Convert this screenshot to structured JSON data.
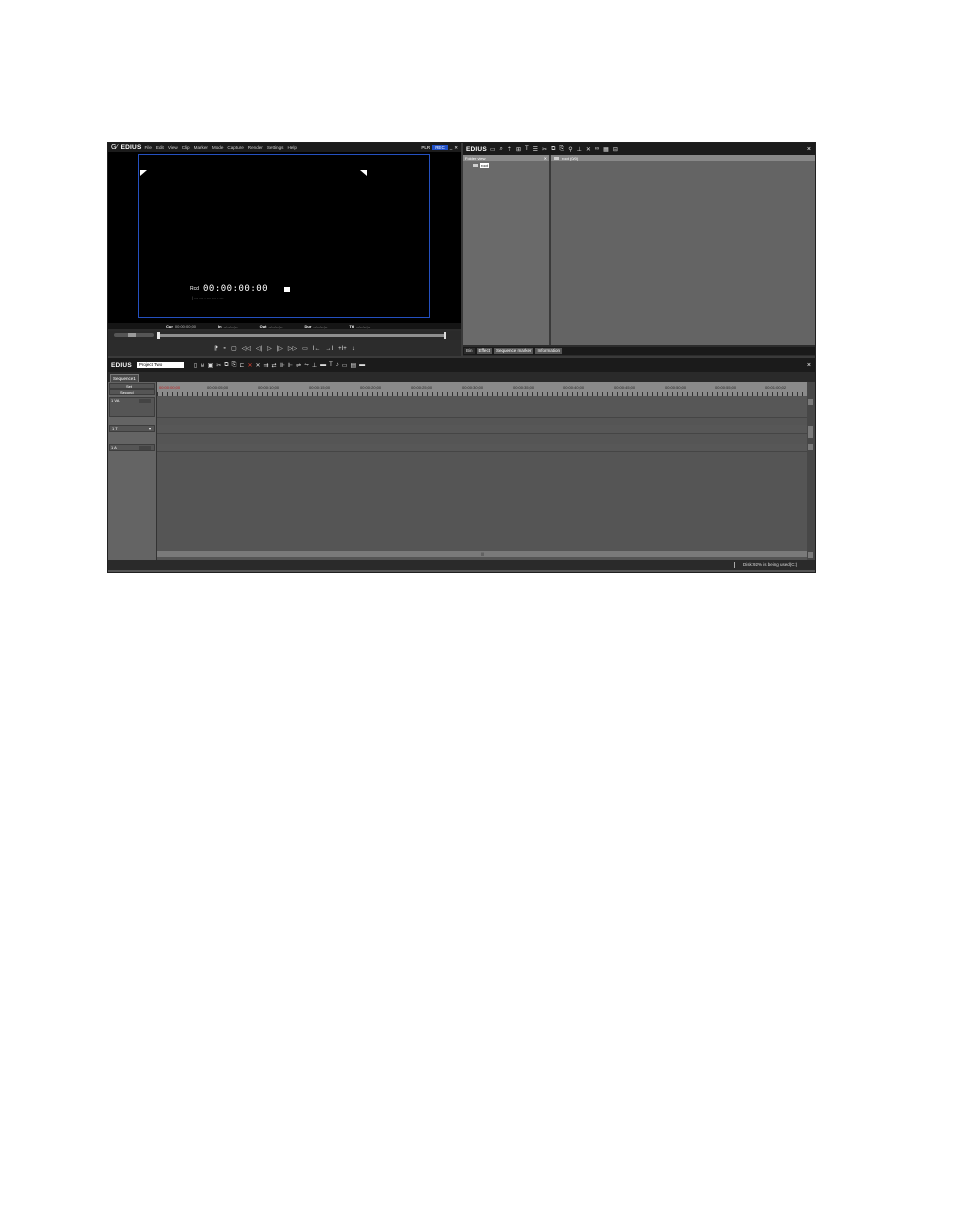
{
  "player": {
    "logo": "EDIUS",
    "menu": [
      "File",
      "Edit",
      "View",
      "Clip",
      "Marker",
      "Mode",
      "Capture",
      "Render",
      "Settings",
      "Help"
    ],
    "mode_label": "PLR",
    "mode_selected": "REC",
    "timecode_label": "Rcd",
    "timecode_value": "00:00:00:00",
    "timecode_dashes": "|  --- --- - --- ---  - ---",
    "info": {
      "cur_label": "Cur",
      "cur_value": "00:00:00;00",
      "in_label": "In",
      "in_value": "--:--:--;--",
      "out_label": "Out",
      "out_value": "--:--:--;--",
      "dur_label": "Dur",
      "dur_value": "--:--:--;--",
      "ttl_label": "Ttl",
      "ttl_value": "--:--:--;--"
    },
    "transport": [
      "⁋",
      "⁌",
      "▢",
      "◁◁",
      "◁|",
      "▷",
      "|▷",
      "▷▷",
      "▭",
      "I←",
      "→I",
      "+I+",
      "↓"
    ]
  },
  "bin": {
    "logo": "EDIUS",
    "toolbar_icons": [
      "folder-icon",
      "search-icon",
      "up-icon",
      "add-icon",
      "title-icon",
      "list-icon",
      "cut-icon",
      "copy-icon",
      "paste-icon",
      "pin-icon",
      "underline-icon",
      "delete-icon",
      "link-icon",
      "grid-icon",
      "view-icon"
    ],
    "close": "×",
    "folder_header": "Folder view",
    "folder_item": "root",
    "clip_header": "root (0/0)",
    "tabs": [
      "Bin",
      "Effect",
      "Sequence marker",
      "Information"
    ],
    "active_tab": "Bin"
  },
  "timeline": {
    "logo": "EDIUS",
    "project_name": "Project Two",
    "close": "×",
    "sequence_tab": "Sequence1",
    "ruler_start": "00:00:00;00",
    "ruler_labels": [
      "00:00:05;00",
      "00:00:10;00",
      "00:00:15;00",
      "00:00:20;00",
      "00:00:25;00",
      "00:00:30;00",
      "00:00:35;00",
      "00:00:40;00",
      "00:00:45;00",
      "00:00:50;00",
      "00:00:55;00",
      "00:01:00;02"
    ],
    "header_top": "Set",
    "header_second": "Second",
    "tracks": [
      {
        "name": "1 VA"
      },
      {
        "name": "1 T"
      },
      {
        "name": "1 A"
      }
    ],
    "status": "Disk:92% is being used(C:)"
  },
  "colors": {
    "accent": "#2450c0",
    "panel_dark": "#1b1b1b",
    "panel_mid": "#646464",
    "red_timecode": "#c02020"
  }
}
